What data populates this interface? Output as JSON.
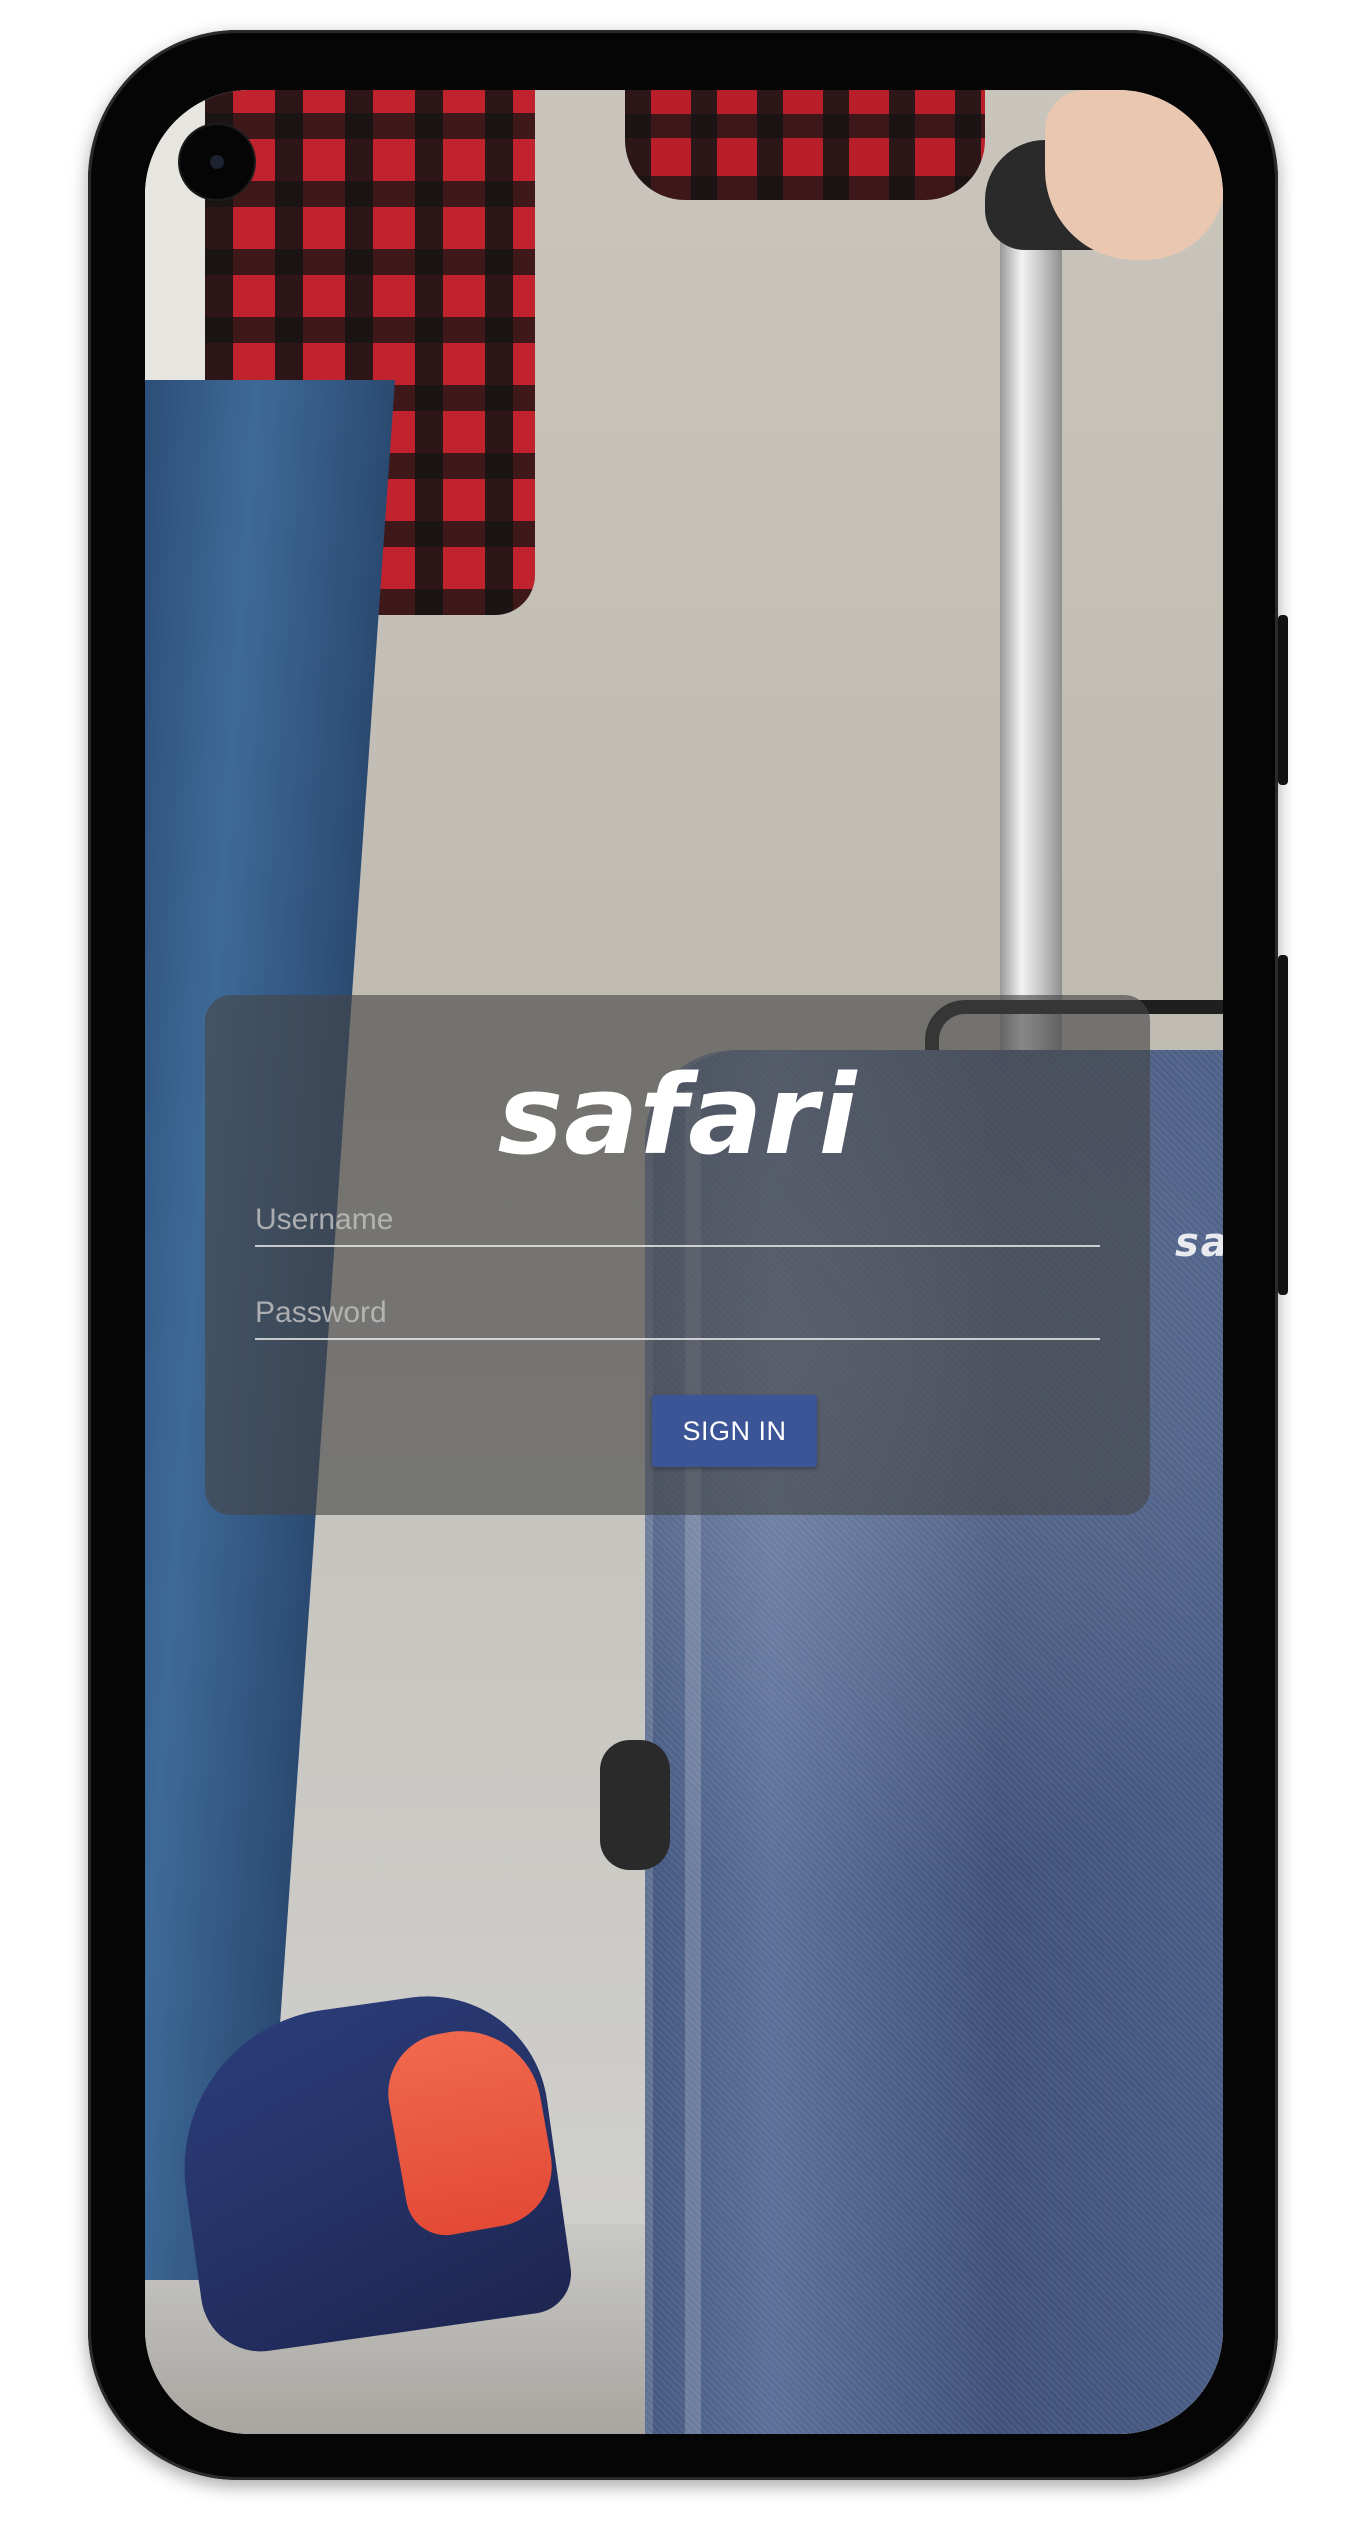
{
  "brand": {
    "logo_text": "safari",
    "suitcase_logo_text": "sa"
  },
  "login": {
    "username_placeholder": "Username",
    "username_value": "",
    "password_placeholder": "Password",
    "password_value": "",
    "signin_label": "SIGN IN"
  },
  "colors": {
    "button_bg": "#3c5597",
    "card_overlay": "rgba(70,70,70,0.62)",
    "text": "#ffffff"
  }
}
